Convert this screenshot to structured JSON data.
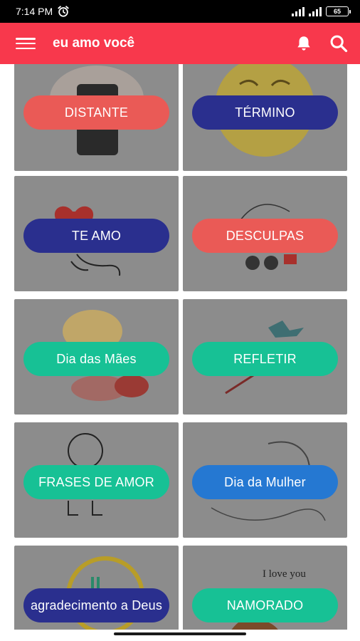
{
  "status_bar": {
    "time": "7:14 PM",
    "battery": "65"
  },
  "app_bar": {
    "title": "eu amo você",
    "color": "#f8384c"
  },
  "categories": [
    {
      "label": "DISTANTE",
      "color": "#ea5a56"
    },
    {
      "label": "TÉRMINO",
      "color": "#2a2f8e"
    },
    {
      "label": "TE AMO",
      "color": "#2a2f8e"
    },
    {
      "label": "DESCULPAS",
      "color": "#ea5a56"
    },
    {
      "label": "Dia das Mães",
      "color": "#17c195"
    },
    {
      "label": "REFLETIR",
      "color": "#17c195"
    },
    {
      "label": "FRASES DE AMOR",
      "color": "#17c195"
    },
    {
      "label": "Dia da Mulher",
      "color": "#2578d2"
    },
    {
      "label": "agradecimento a Deus",
      "color": "#2a2f8e"
    },
    {
      "label": "NAMORADO",
      "color": "#17c195"
    }
  ],
  "artwork": {
    "love_note": "I love you"
  },
  "icons": {
    "menu": "hamburger-menu-icon",
    "notifications": "bell-icon",
    "search": "magnifier-icon",
    "alarm": "alarm-clock-icon"
  }
}
